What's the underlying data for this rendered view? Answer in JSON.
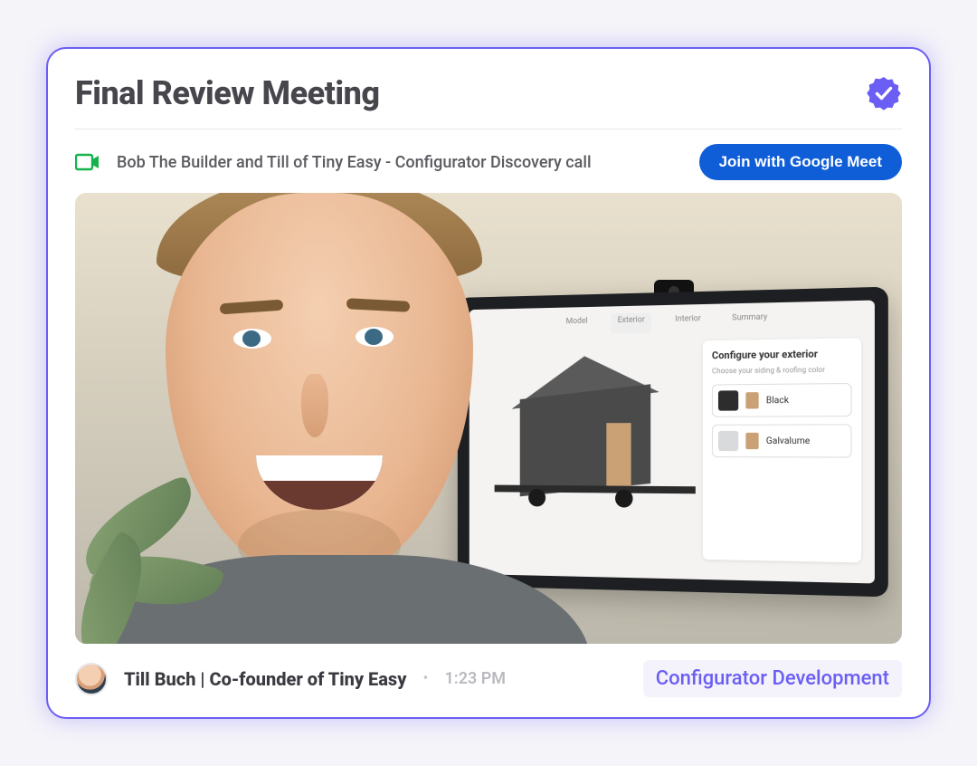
{
  "header": {
    "title": "Final Review Meeting"
  },
  "meeting": {
    "title": "Bob The Builder and Till of Tiny Easy - Configurator Discovery call",
    "join_label": "Join with Google Meet"
  },
  "screen": {
    "panel_title": "Configure your exterior",
    "panel_subtitle": "Choose your siding & roofing color",
    "options": [
      {
        "label": "Black",
        "color": "#2d2d2d"
      },
      {
        "label": "Galvalume",
        "color": "#d8dadb"
      }
    ]
  },
  "footer": {
    "person": "Till Buch | Co-founder of Tiny Easy",
    "time": "1:23 PM",
    "tag": "Configurator Development"
  },
  "colors": {
    "accent": "#6b5ef5",
    "join_btn": "#0f5ed7",
    "camera": "#16b24b"
  }
}
